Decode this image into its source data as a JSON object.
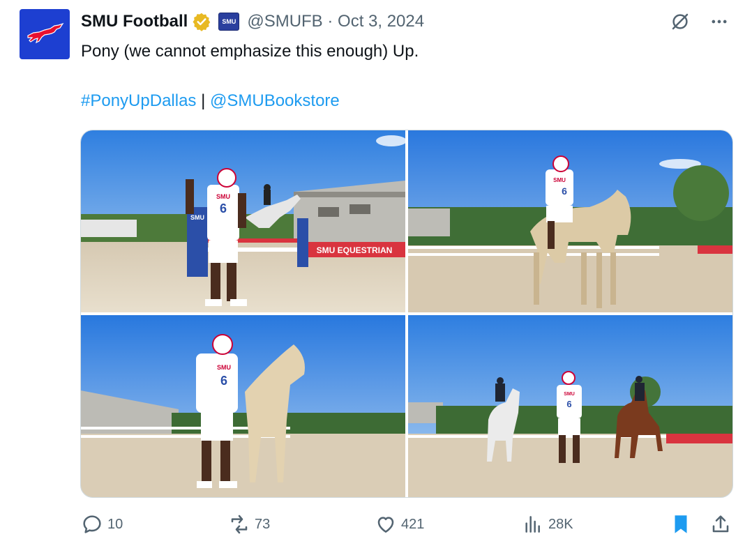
{
  "account": {
    "name": "SMU Football",
    "affiliate_badge": "SMU",
    "handle_date": "@SMUFB · Oct 3, 2024",
    "avatar_icon": "mustang-logo-icon",
    "verified_icon": "gold-verified-badge-icon"
  },
  "tweet": {
    "text": "Pony (we cannot emphasize this enough) Up.",
    "hashtag": "#PonyUpDallas",
    "separator": "|",
    "mention": "@SMUBookstore"
  },
  "media": {
    "photo1": {
      "jersey_top": "SMU",
      "jersey_number": "6",
      "banner_text": "SMU EQUESTRIAN",
      "standard_text": "SMU"
    },
    "photo2": {
      "jersey_top": "SMU",
      "jersey_number": "6"
    },
    "photo3": {
      "jersey_top": "SMU",
      "jersey_number": "6"
    },
    "photo4": {
      "jersey_top": "SMU",
      "jersey_number": "6"
    }
  },
  "actions": {
    "replies": "10",
    "reposts": "73",
    "likes": "421",
    "views": "28K"
  },
  "colors": {
    "link": "#1d9bf0",
    "muted": "#536471",
    "bookmark_active": "#1d9bf0",
    "smu_blue": "#1d3fd1",
    "smu_red": "#cc0035"
  }
}
